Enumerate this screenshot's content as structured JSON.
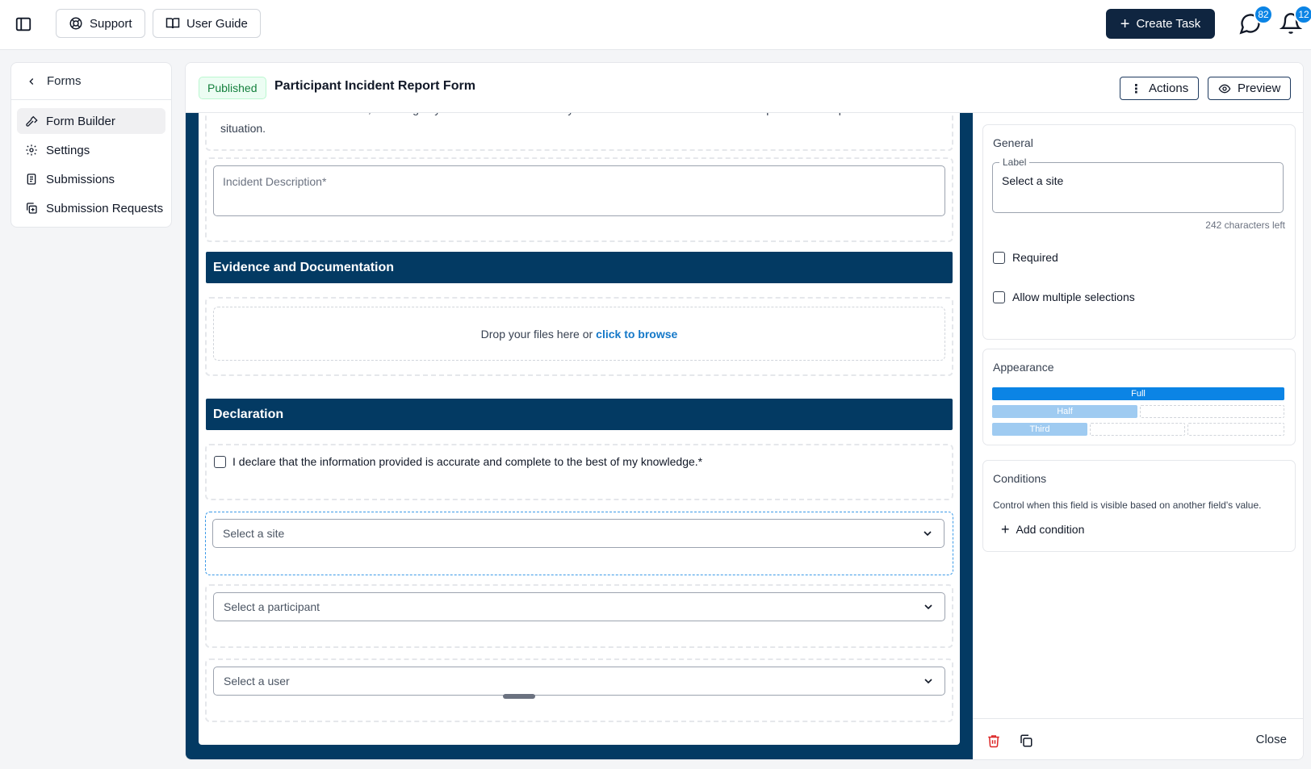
{
  "topbar": {
    "support_label": "Support",
    "user_guide_label": "User Guide",
    "create_task_label": "Create Task",
    "messages_count": "82",
    "notifications_count": "12"
  },
  "leftnav": {
    "back_label": "Forms",
    "items": [
      {
        "label": "Form Builder",
        "icon": "hammer-icon",
        "active": true
      },
      {
        "label": "Settings",
        "icon": "gear-icon"
      },
      {
        "label": "Submissions",
        "icon": "document-icon"
      },
      {
        "label": "Submission Requests",
        "icon": "copy-plus-icon"
      }
    ]
  },
  "header": {
    "status": "Published",
    "title": "Participant Incident Report Form",
    "actions_label": "Actions",
    "preview_label": "Preview"
  },
  "form": {
    "description": "Describe the incident in detail, including any actions taken immediately after. Provide as much information as possible to help us assess the situation.",
    "incident_placeholder": "Incident Description*",
    "section_evidence": "Evidence and Documentation",
    "drop_text": "Drop your files here or",
    "drop_link": "click to browse",
    "section_declaration": "Declaration",
    "declaration_text": "I declare that the information provided is accurate and complete to the best of my knowledge.*",
    "select_site": "Select a site",
    "select_participant": "Select a participant",
    "select_user": "Select a user"
  },
  "properties": {
    "general_title": "General",
    "label_legend": "Label",
    "label_value": "Select a site",
    "chars_left": "242 characters left",
    "required_label": "Required",
    "multiple_label": "Allow multiple selections",
    "appearance_title": "Appearance",
    "width_full": "Full",
    "width_half": "Half",
    "width_third": "Third",
    "conditions_title": "Conditions",
    "conditions_text": "Control when this field is visible based on another field's value.",
    "add_condition_label": "Add condition",
    "close_label": "Close"
  },
  "colors": {
    "brand_navy": "#033a63",
    "accent_blue": "#0b84e5",
    "delete_red": "#dc2626"
  }
}
